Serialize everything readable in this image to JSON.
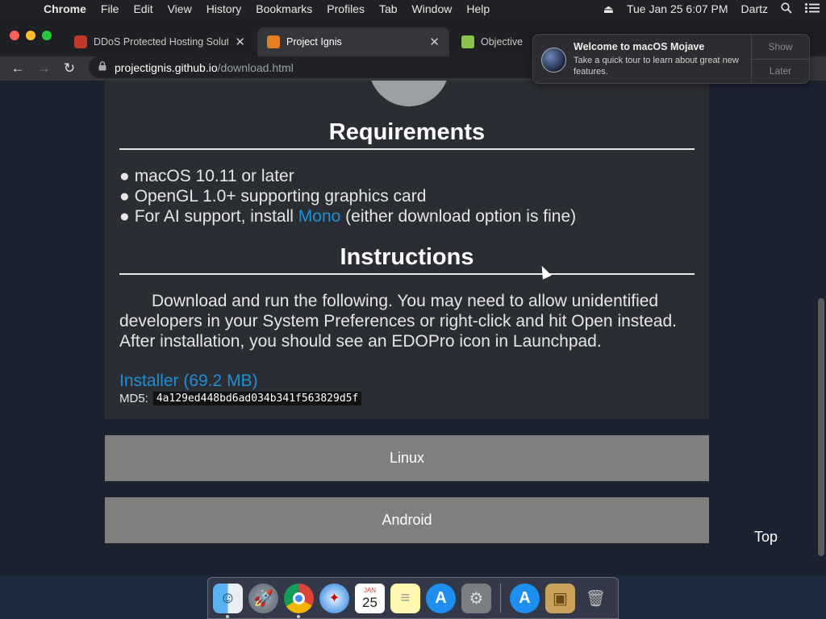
{
  "menubar": {
    "app_name": "Chrome",
    "items": [
      "File",
      "Edit",
      "View",
      "History",
      "Bookmarks",
      "Profiles",
      "Tab",
      "Window",
      "Help"
    ],
    "clock": "Tue Jan 25  6:07 PM",
    "user": "Dartz"
  },
  "tabs": [
    {
      "title": "DDoS Protected Hosting Soluti",
      "favicon_color": "#c0392b",
      "active": false
    },
    {
      "title": "Project Ignis",
      "favicon_color": "#e67e22",
      "active": true
    },
    {
      "title": "Objective-S",
      "favicon_color": "#8bc34a",
      "active": false
    }
  ],
  "toolbar": {
    "url_host": "projectignis.github.io",
    "url_path": "/download.html"
  },
  "notification": {
    "title": "Welcome to macOS Mojave",
    "body": "Take a quick tour to learn about great new features.",
    "show_label": "Show",
    "later_label": "Later"
  },
  "content": {
    "requirements_title": "Requirements",
    "requirements": {
      "bullet": "●",
      "item1": "macOS 10.11 or later",
      "item2": "OpenGL 1.0+ supporting graphics card",
      "item3_prefix": "For AI support, install ",
      "item3_link": "Mono",
      "item3_suffix": " (either download option is fine)"
    },
    "instructions_title": "Instructions",
    "instructions_text": "Download and run the following. You may need to allow unidentified developers in your System Preferences or right-click and hit Open instead. After installation, you should see an EDOPro icon in Launchpad.",
    "installer_label": "Installer (69.2 MB)",
    "md5_label": "MD5:",
    "md5_value": "4a129ed448bd6ad034b341f563829d5f",
    "linux_label": "Linux",
    "android_label": "Android",
    "top_label": "Top"
  },
  "dock": {
    "finder_glyph": "☺",
    "rocket_glyph": "🚀",
    "calendar_month": "JAN",
    "calendar_day": "25",
    "notes_glyph": "≡",
    "appstore_glyph": "A",
    "settings_glyph": "⚙",
    "package_glyph": "▣",
    "trash_glyph": "🗑",
    "apps": [
      "finder",
      "launchpad",
      "chrome",
      "safari",
      "calendar",
      "notes",
      "app-store",
      "system-preferences",
      "app-store-downloads",
      "archive-utility",
      "trash"
    ]
  }
}
